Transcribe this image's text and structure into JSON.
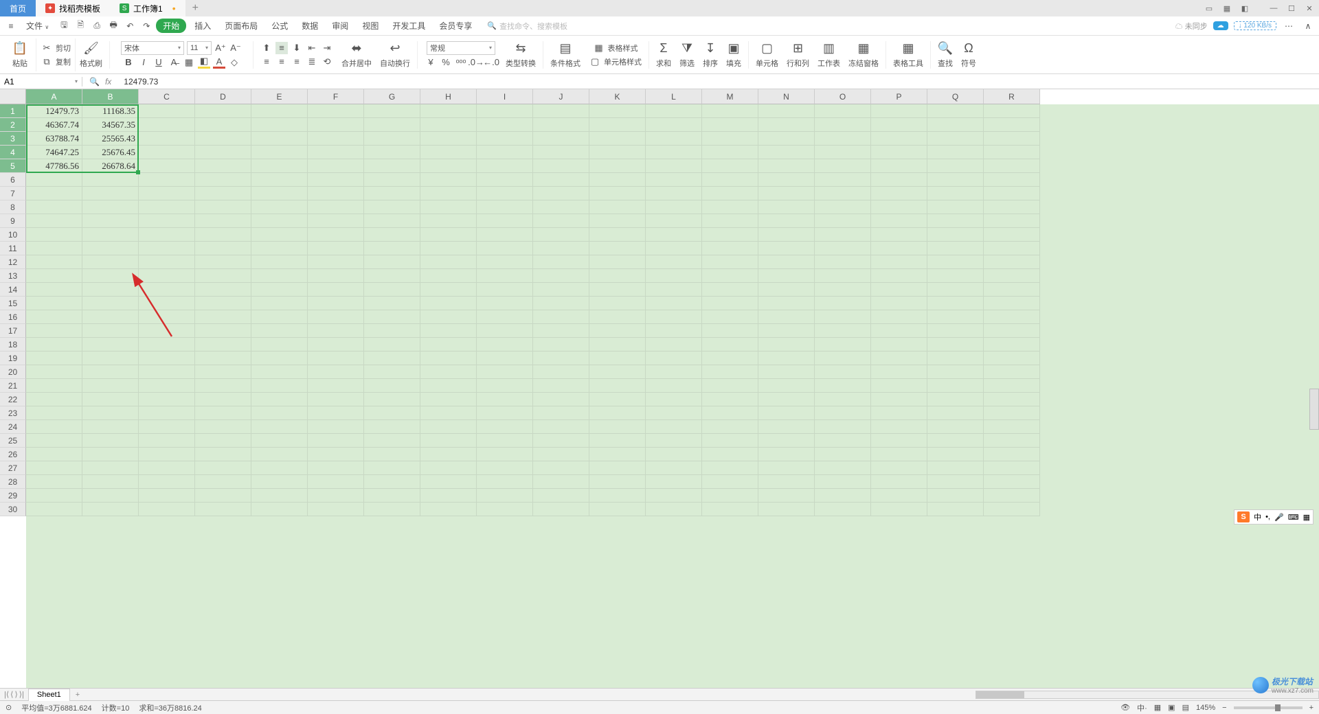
{
  "tabs": {
    "home": "首页",
    "template_icon_bg": "#e34b3d",
    "template": "找稻壳模板",
    "workbook_icon_bg": "#2fa84f",
    "workbook": "工作簿1"
  },
  "window": {
    "speed": "120 KB/s"
  },
  "menu": {
    "file": "文件",
    "items": [
      "开始",
      "插入",
      "页面布局",
      "公式",
      "数据",
      "审阅",
      "视图",
      "开发工具",
      "会员专享"
    ],
    "search_placeholder": "查找命令、搜索模板",
    "unsync": "未同步"
  },
  "ribbon": {
    "paste": "粘贴",
    "cut": "剪切",
    "copy": "复制",
    "format_painter": "格式刷",
    "font_name": "宋体",
    "font_size": "11",
    "merge_center": "合并居中",
    "wrap": "自动换行",
    "number_format": "常规",
    "type_convert": "类型转换",
    "cond_fmt": "条件格式",
    "table_style": "表格样式",
    "cell_style": "单元格样式",
    "sum": "求和",
    "filter": "筛选",
    "sort": "排序",
    "fill": "填充",
    "cell": "单元格",
    "row_col": "行和列",
    "worksheet": "工作表",
    "freeze": "冻结窗格",
    "table_tool": "表格工具",
    "find": "查找",
    "symbol": "符号"
  },
  "formula_bar": {
    "name": "A1",
    "value": "12479.73"
  },
  "columns": [
    "A",
    "B",
    "C",
    "D",
    "E",
    "F",
    "G",
    "H",
    "I",
    "J",
    "K",
    "L",
    "M",
    "N",
    "O",
    "P",
    "Q",
    "R"
  ],
  "rows": 30,
  "selected_cols": [
    0,
    1
  ],
  "selected_rows": [
    0,
    1,
    2,
    3,
    4
  ],
  "cells": [
    [
      "12479.73",
      "11168.35"
    ],
    [
      "46367.74",
      "34567.35"
    ],
    [
      "63788.74",
      "25565.43"
    ],
    [
      "74647.25",
      "25676.45"
    ],
    [
      "47786.56",
      "26678.64"
    ]
  ],
  "sheet": {
    "name": "Sheet1"
  },
  "status": {
    "avg_label": "平均值=",
    "avg": "3万6881.624",
    "count_label": "计数=",
    "count": "10",
    "sum_label": "求和=",
    "sum": "36万8816.24",
    "zoom": "145%"
  },
  "ime": {
    "lang": "中"
  },
  "watermark": {
    "site": "极光下载站",
    "url": "www.xz7.com"
  }
}
